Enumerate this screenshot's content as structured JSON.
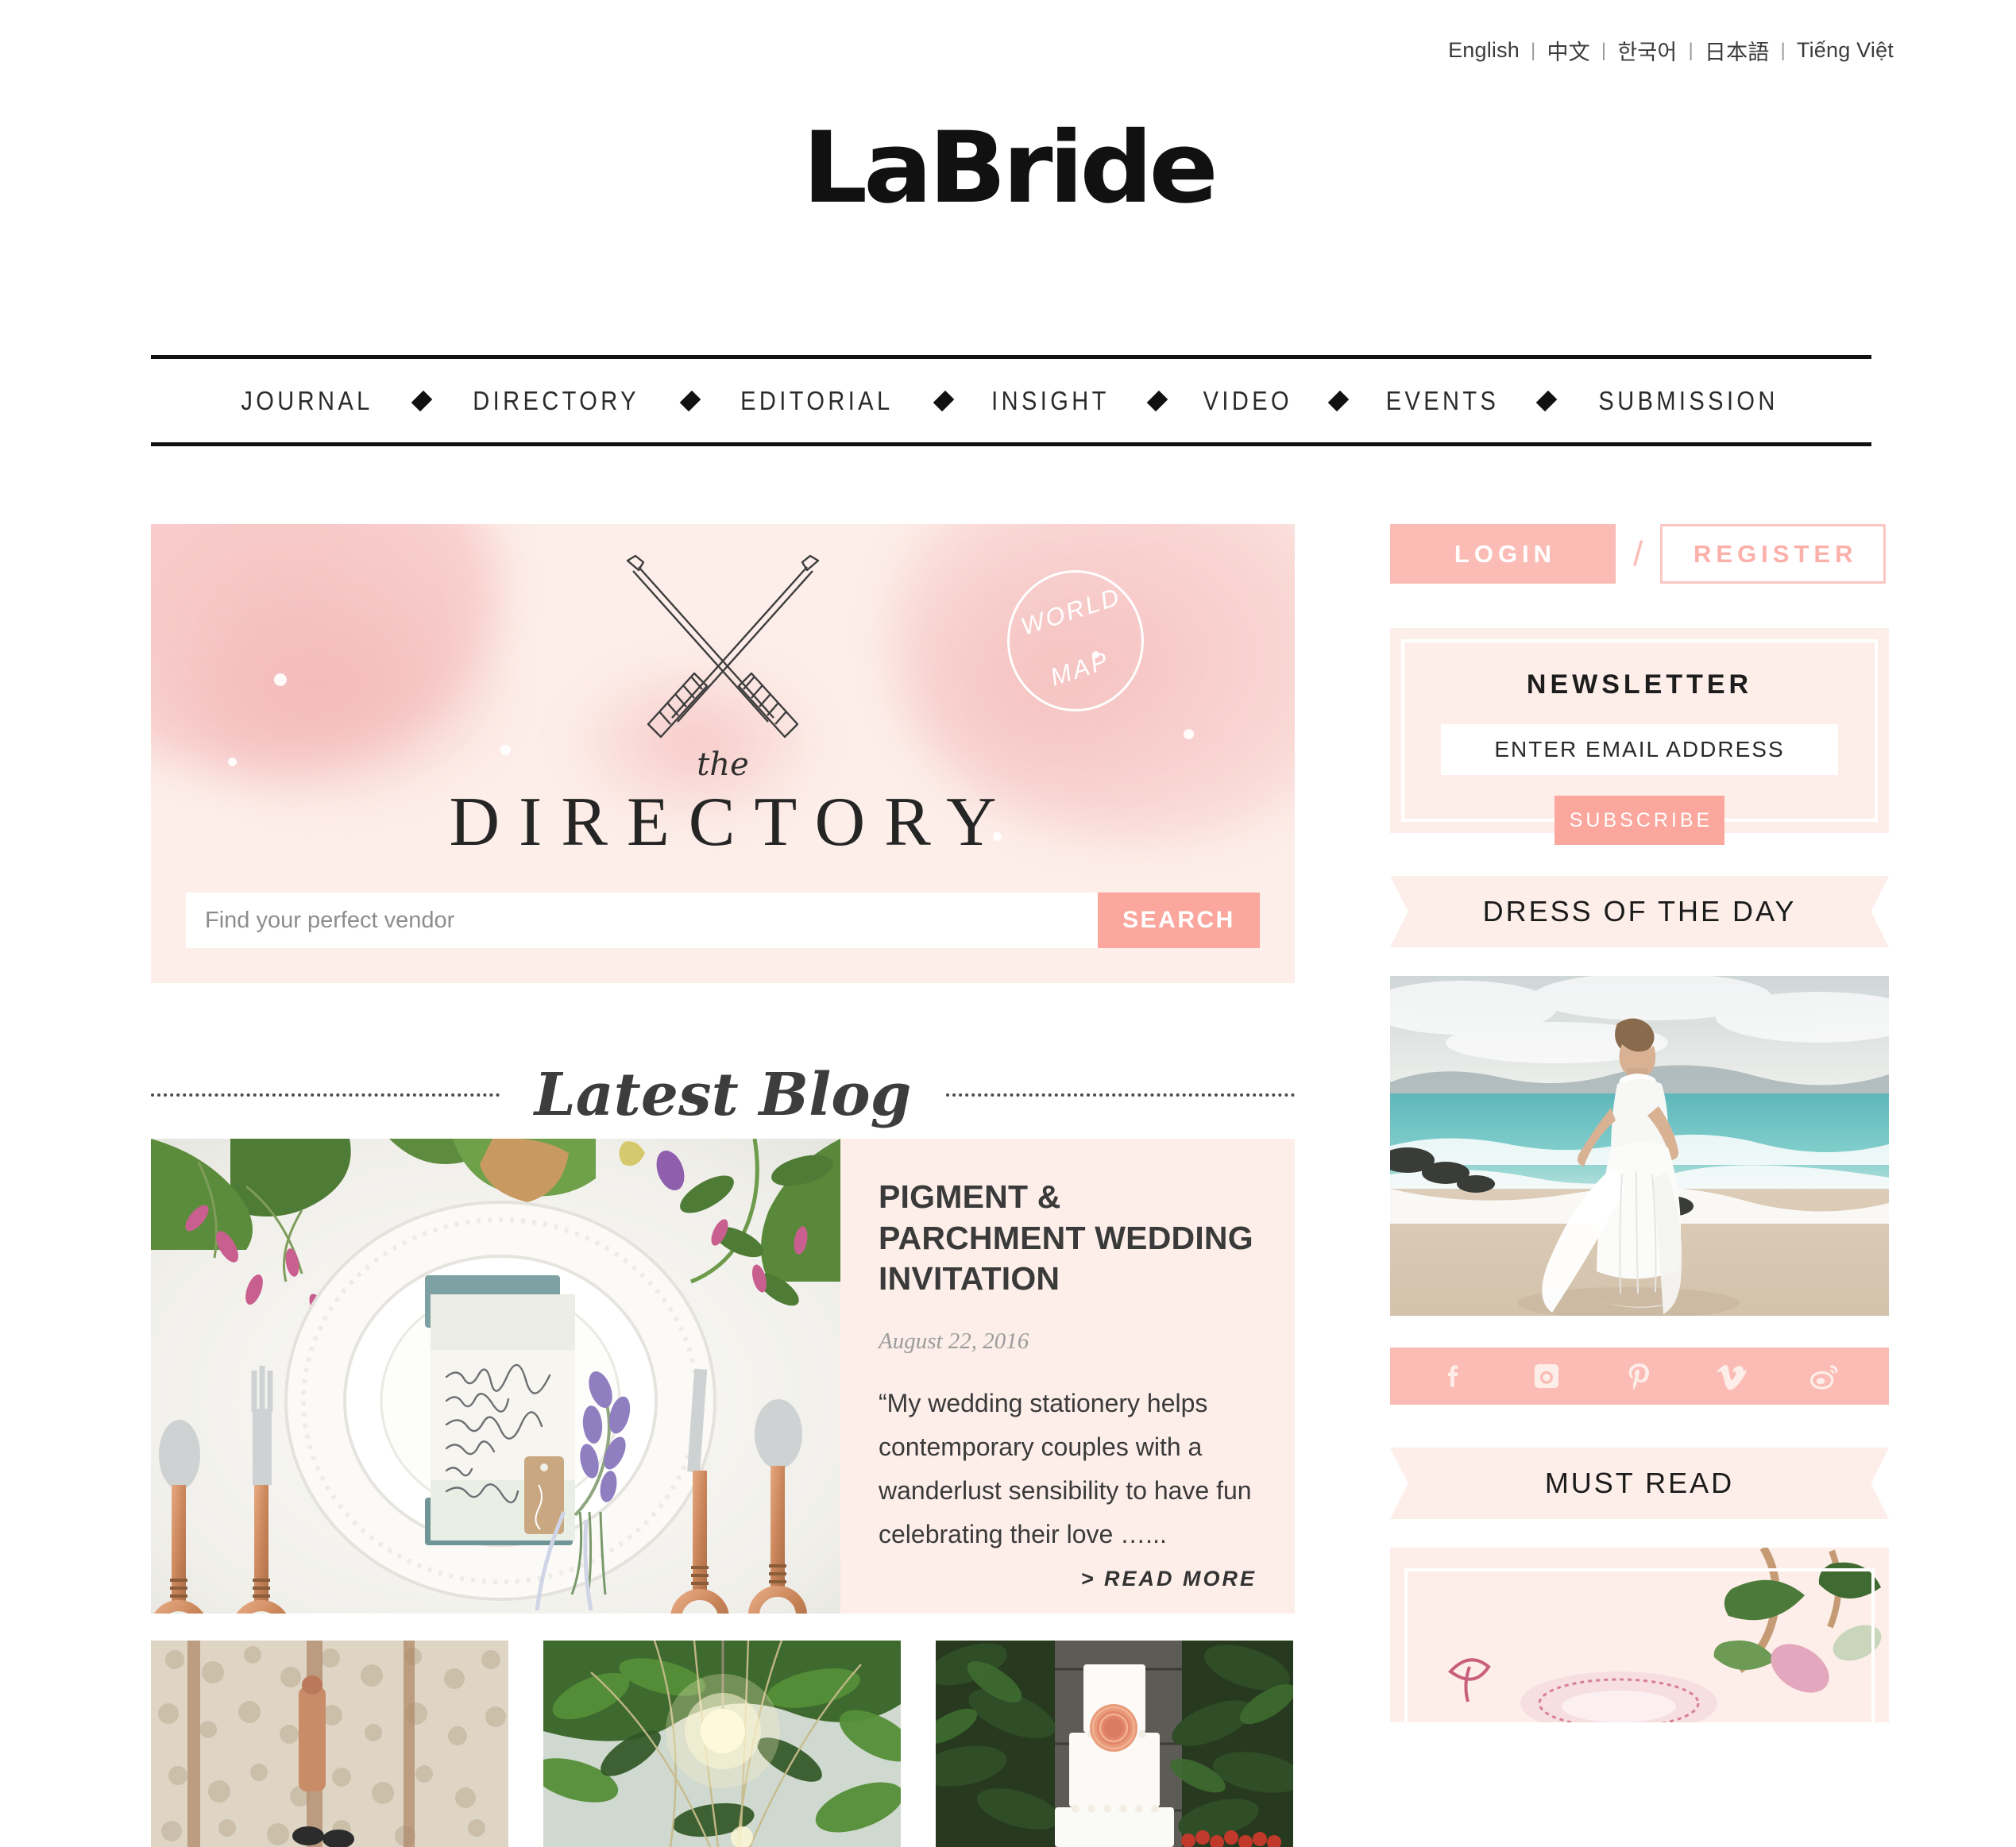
{
  "languages": [
    {
      "label": "English"
    },
    {
      "label": "中文"
    },
    {
      "label": "한국어"
    },
    {
      "label": "日本語"
    },
    {
      "label": "Tiếng Việt"
    }
  ],
  "separator": "|",
  "brand": {
    "logo_text": "LaBride"
  },
  "nav": {
    "items": [
      {
        "label": "JOURNAL"
      },
      {
        "label": "DIRECTORY"
      },
      {
        "label": "EDITORIAL"
      },
      {
        "label": "INSIGHT"
      },
      {
        "label": "VIDEO"
      },
      {
        "label": "EVENTS"
      },
      {
        "label": "SUBMISSION"
      }
    ],
    "separator_icon": "diamond-icon"
  },
  "hero": {
    "eyebrow": "the",
    "title": "DIRECTORY",
    "world_map_line1": "WORLD",
    "world_map_line2": "MAP",
    "search_placeholder": "Find your perfect vendor",
    "search_value": "",
    "search_button": "SEARCH",
    "arrows_icon": "crossed-arrows-icon"
  },
  "latest_blog": {
    "heading": "Latest Blog",
    "post": {
      "title": "PIGMENT & PARCHMENT WEDDING INVITATION",
      "date": "August 22, 2016",
      "excerpt": "“My wedding stationery helps contemporary couples with a wanderlust sensibility to have fun celebrating their love …...",
      "read_more": "> READ MORE",
      "image_alt": "wedding-table-setting-photo"
    },
    "thumbnails": [
      {
        "alt": "stone-wall-photo"
      },
      {
        "alt": "hanging-lights-greenery-photo"
      },
      {
        "alt": "white-wedding-cake-photo"
      }
    ]
  },
  "sidebar": {
    "login_label": "LOGIN",
    "divider": "/",
    "register_label": "REGISTER",
    "newsletter": {
      "title": "NEWSLETTER",
      "email_placeholder": "ENTER EMAIL ADDRESS",
      "email_value": "",
      "subscribe_label": "SUBSCRIBE"
    },
    "dress_of_the_day": {
      "heading": "DRESS OF THE DAY",
      "image_alt": "bride-on-beach-photo"
    },
    "social": [
      {
        "name": "facebook-icon"
      },
      {
        "name": "instagram-icon"
      },
      {
        "name": "pinterest-icon"
      },
      {
        "name": "vimeo-icon"
      },
      {
        "name": "weibo-icon"
      }
    ],
    "must_read": {
      "heading": "MUST READ",
      "image_alt": "floral-illustration-card"
    }
  },
  "colors": {
    "accent_pink": "#fba79e",
    "soft_pink": "#fbbcb6",
    "blush_bg": "#fdeee9",
    "ink": "#2a2a2a"
  }
}
